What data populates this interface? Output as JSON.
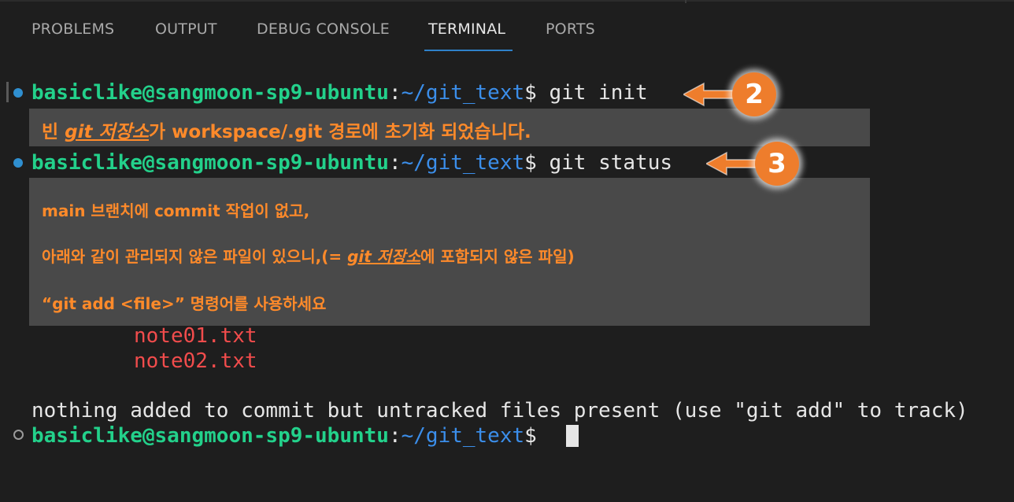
{
  "tabs": [
    {
      "label": "PROBLEMS"
    },
    {
      "label": "OUTPUT"
    },
    {
      "label": "DEBUG CONSOLE"
    },
    {
      "label": "TERMINAL"
    },
    {
      "label": "PORTS"
    }
  ],
  "active_tab": "TERMINAL",
  "prompt": {
    "user_host": "basiclike@sangmoon-sp9-ubuntu",
    "colon": ":",
    "path": "~/git_text",
    "dollar": "$"
  },
  "commands": {
    "cmd1": " git init",
    "cmd2": " git status",
    "cmd3": " "
  },
  "untracked_files": [
    "note01.txt",
    "note02.txt"
  ],
  "summary_line": "nothing added to commit but untracked files present (use \"git add\" to track)",
  "callout1": {
    "pre": "빈 ",
    "em": "git 저장소",
    "post": "가 workspace/.git 경로에 초기화 되었습니다."
  },
  "callout2": {
    "line1": "main 브랜치에 commit 작업이 없고,",
    "line2_pre": "아래와 같이 관리되지 않은 파일이 있으니,(= ",
    "line2_em": "git 저장소",
    "line2_post": "에 포함되지 않은 파일)",
    "line3": "“git add <file>” 명령어를 사용하세요"
  },
  "badges": {
    "first": "2",
    "second": "3"
  },
  "colors": {
    "background": "#1e1e1e",
    "prompt_green": "#23d18b",
    "path_blue": "#3b8eea",
    "untracked_red": "#f14c4c",
    "annotation_orange": "#ff8a2a",
    "badge_orange": "#ee7d2c",
    "active_tab_underline": "#2f81c9"
  }
}
